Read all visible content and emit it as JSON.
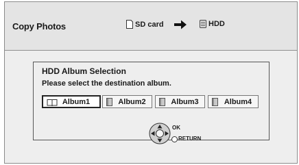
{
  "header": {
    "title": "Copy Photos",
    "source": {
      "label": "SD card",
      "icon": "sd-card-icon"
    },
    "arrow_icon": "arrow-right-icon",
    "destination": {
      "label": "HDD",
      "icon": "hdd-icon"
    }
  },
  "dialog": {
    "title": "HDD Album Selection",
    "message": "Please select the destination album.",
    "albums": [
      {
        "label": "Album1",
        "icon": "open-album-icon",
        "selected": true
      },
      {
        "label": "Album2",
        "icon": "closed-album-icon",
        "selected": false
      },
      {
        "label": "Album3",
        "icon": "closed-album-icon",
        "selected": false
      },
      {
        "label": "Album4",
        "icon": "closed-album-icon",
        "selected": false
      }
    ]
  },
  "controls": {
    "ok_label": "OK",
    "return_label": "RETURN"
  },
  "colors": {
    "screen_bg": "#eeeeee",
    "header_bg": "#e4e4e4",
    "border": "#555555",
    "text": "#1a1a1a"
  }
}
